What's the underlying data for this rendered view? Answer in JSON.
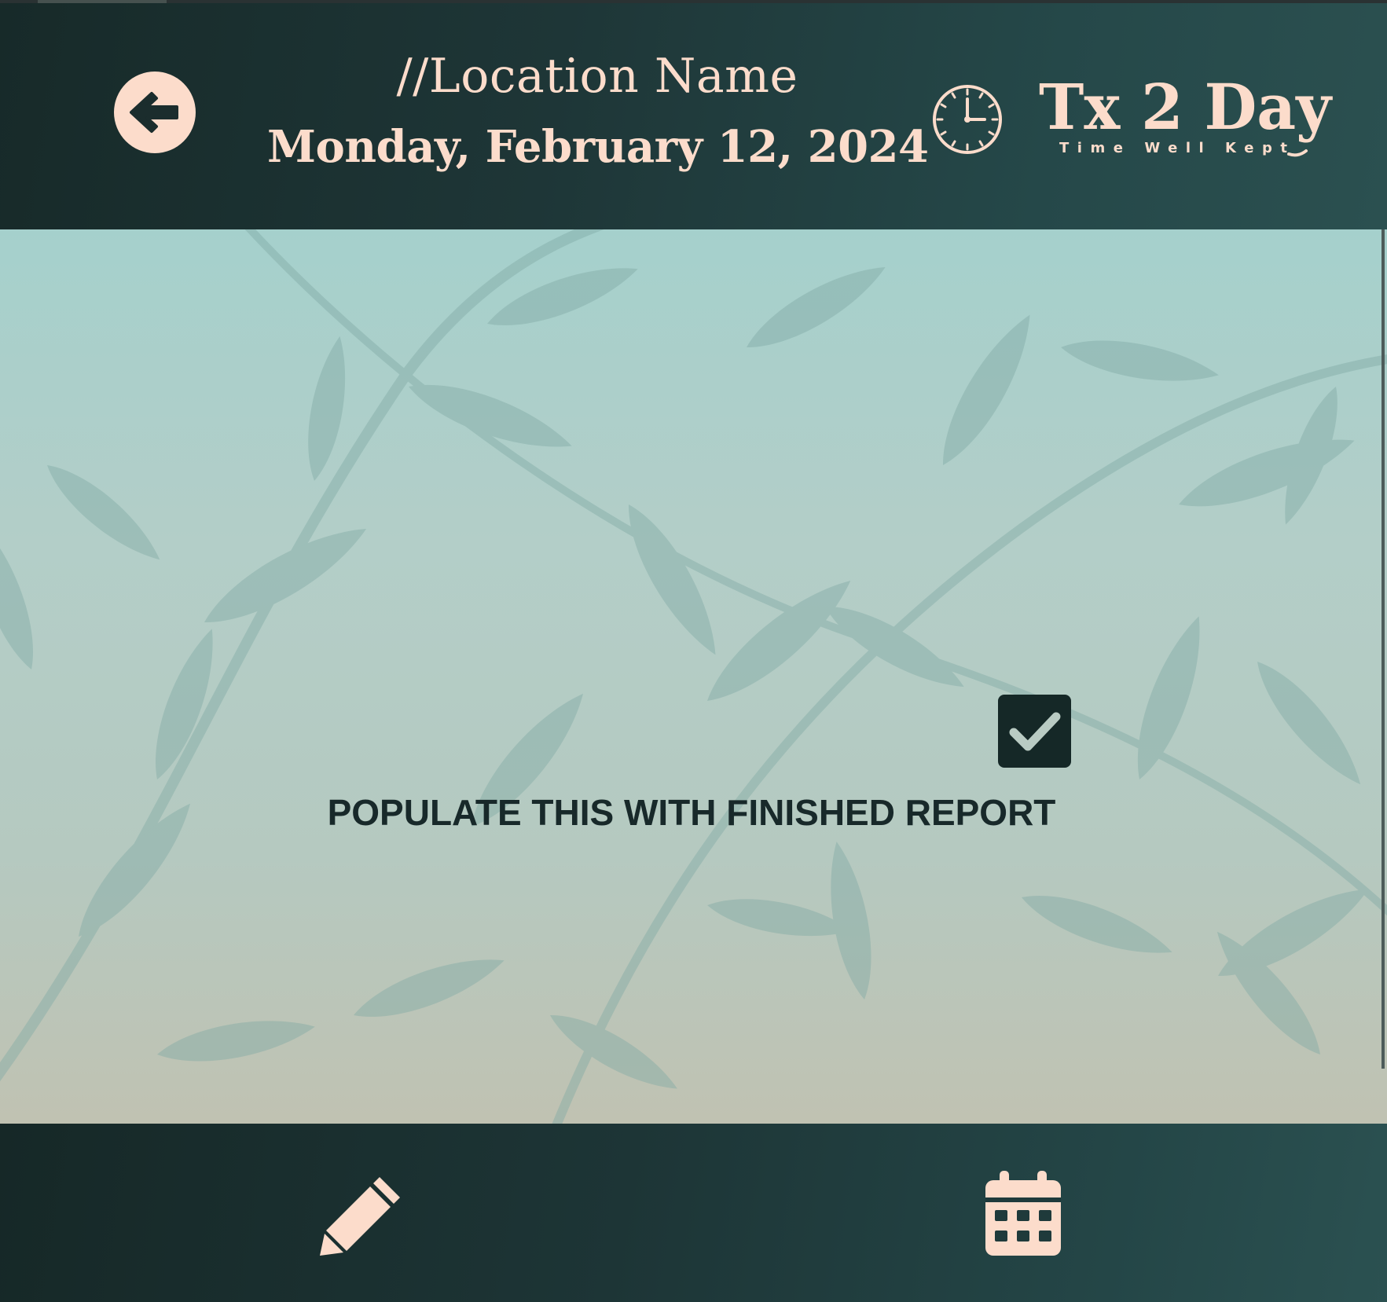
{
  "header": {
    "location_name": "//Location Name",
    "date": "Monday, February 12, 2024"
  },
  "logo": {
    "title": "Tx 2 Day",
    "tagline": "Time Well Kept"
  },
  "main": {
    "placeholder_text": "POPULATE THIS WITH FINISHED REPORT",
    "checkbox_checked": true
  },
  "icons": {
    "back": "arrow-left-circle-icon",
    "clock": "clock-icon",
    "checkbox": "checkbox-checked-icon",
    "edit": "pencil-icon",
    "calendar": "calendar-icon"
  },
  "colors": {
    "accent": "#fcdccb",
    "header_dark": "#172a29",
    "header_light": "#2b5050",
    "text_dark": "#18292a"
  }
}
